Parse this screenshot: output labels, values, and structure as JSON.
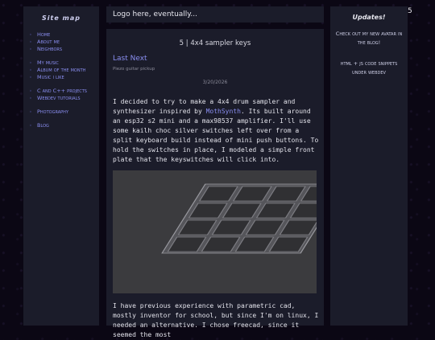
{
  "sitemap": {
    "title": "Site map",
    "groups": [
      {
        "items": [
          "Home",
          "About me",
          "Neighbors"
        ]
      },
      {
        "items": [
          "My music",
          "Album of the month",
          "Music i like"
        ]
      },
      {
        "items": [
          "C and C++ projects",
          "Webdev tutorials"
        ]
      },
      {
        "items": [
          "Photography"
        ]
      },
      {
        "items": [
          "Blog"
        ]
      }
    ]
  },
  "header": {
    "logo_text": "Logo here, eventually..."
  },
  "corner_number": "5",
  "post": {
    "title": "5 | 4x4 sampler keys",
    "next_label": "Last Next",
    "next_sub": "Piezo guitar pickup",
    "date": "3/20/2026",
    "para1_before": "I decided to try to make a 4x4 drum sampler and synthesizer inspired by ",
    "para1_link": "MothSynth",
    "para1_after": ". Its built around an esp32 s2 mini and a max98537 amplifier. I'll use some kailh choc silver switches left over from a split keyboard build instead of mini push buttons. To hold the switches in place, I modeled a simple front plate that the keyswitches will click into.",
    "para2": "I have previous experience with parametric cad, mostly inventor for school, but since I'm on linux, I needed an alternative. I chose freecad, since it seemed the most"
  },
  "updates": {
    "title": "Updates!",
    "items": [
      "Check out my new avatar in the blog!",
      "html + js code snippets under webdev"
    ]
  },
  "colors": {
    "panel": "#1b1c2a",
    "link": "#8a8ef0",
    "background": "#0b0714"
  }
}
